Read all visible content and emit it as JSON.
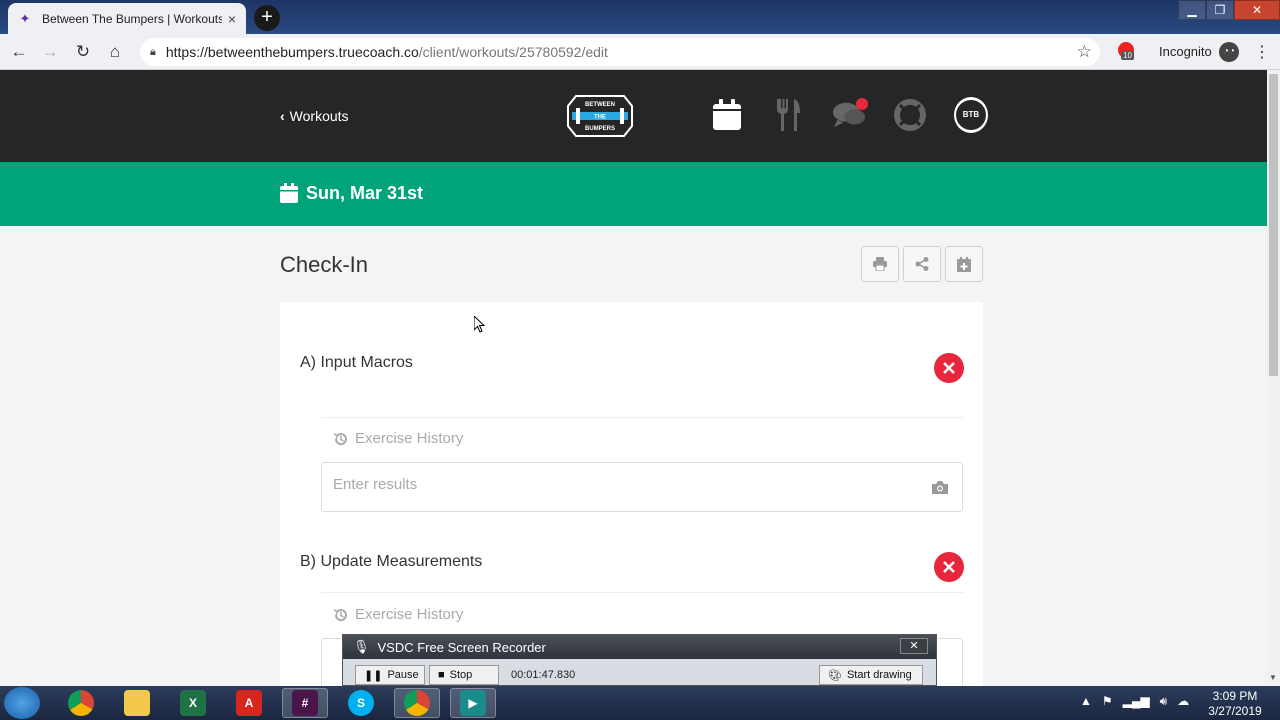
{
  "browser": {
    "tab_title": "Between The Bumpers | Workouts",
    "tab_close": "×",
    "new_tab": "+",
    "url_host": "https://betweenthebumpers.truecoach.co",
    "url_path": "/client/workouts/25780592/edit",
    "incognito_label": "Incognito",
    "extension_badge_count": "10"
  },
  "header": {
    "back_label": "Workouts",
    "logo_text": [
      "BETWEEN",
      "THE",
      "BUMPERS"
    ],
    "avatar_text": "BTB"
  },
  "banner": {
    "date": "Sun, Mar 31st"
  },
  "main": {
    "title": "Check-In",
    "sections": [
      {
        "title": "A) Input Macros",
        "history_label": "Exercise History",
        "results_placeholder": "Enter results"
      },
      {
        "title": "B) Update Measurements",
        "history_label": "Exercise History"
      }
    ]
  },
  "recorder": {
    "title": "VSDC Free Screen Recorder",
    "pause_label": "Pause",
    "stop_label": "Stop",
    "elapsed": "00:01:47.830",
    "draw_label": "Start drawing"
  },
  "taskbar": {
    "time": "3:09 PM",
    "date": "3/27/2019"
  },
  "colors": {
    "header_bg": "#262626",
    "accent_green": "#00a37a",
    "delete_red": "#e8273c"
  }
}
